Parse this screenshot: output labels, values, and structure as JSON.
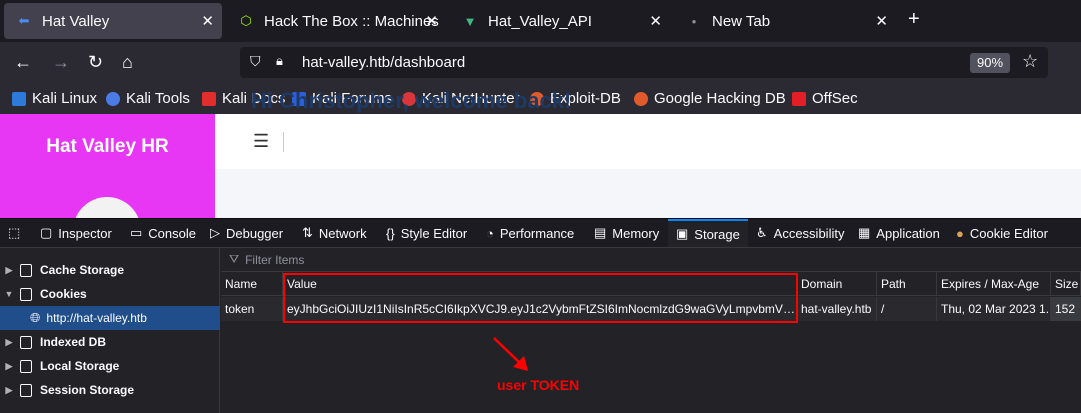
{
  "browser": {
    "tabs": [
      {
        "label": "Hat Valley",
        "active": true
      },
      {
        "label": "Hack The Box :: Machines",
        "active": false
      },
      {
        "label": "Hat_Valley_API",
        "active": false
      },
      {
        "label": "New Tab",
        "active": false
      }
    ],
    "close_glyph": "✕",
    "new_tab_glyph": "+",
    "url": "hat-valley.htb/dashboard",
    "zoom": "90%",
    "bookmarks": [
      {
        "label": "Kali Linux",
        "color": "#2c7bd8"
      },
      {
        "label": "Kali Tools",
        "color": "#4b7be5"
      },
      {
        "label": "Kali Docs",
        "color": "#e22d2d"
      },
      {
        "label": "Kali Forums",
        "color": "#ffffff"
      },
      {
        "label": "Kali NetHunter",
        "color": "#d8363a"
      },
      {
        "label": "Exploit-DB",
        "color": "#e05a2b"
      },
      {
        "label": "Google Hacking DB",
        "color": "#e05a2b"
      },
      {
        "label": "OffSec",
        "color": "#e21f26"
      }
    ]
  },
  "page": {
    "brand": "Hat Valley HR",
    "welcome": "Hi Christopher, welcome back!",
    "sidebar_color": "#e737f5"
  },
  "devtools": {
    "tabs": [
      "Inspector",
      "Console",
      "Debugger",
      "Network",
      "Style Editor",
      "Performance",
      "Memory",
      "Storage",
      "Accessibility",
      "Application",
      "Cookie Editor"
    ],
    "active_tab": "Storage",
    "tree": [
      {
        "label": "Cache Storage",
        "expanded": false
      },
      {
        "label": "Cookies",
        "expanded": true
      },
      {
        "label": "http://hat-valley.htb",
        "selected": true
      },
      {
        "label": "Indexed DB",
        "expanded": false
      },
      {
        "label": "Local Storage",
        "expanded": false
      },
      {
        "label": "Session Storage",
        "expanded": false
      }
    ],
    "filter_placeholder": "Filter Items",
    "columns": [
      "Name",
      "Value",
      "Domain",
      "Path",
      "Expires / Max-Age",
      "Size"
    ],
    "row": {
      "name": "token",
      "value": "eyJhbGciOiJIUzI1NiIsInR5cCI6IkpXVCJ9.eyJ1c2VybmFtZSI6ImNocmlzdG9waGVyLmpvbmVzIiwiaWF0...",
      "domain": "hat-valley.htb",
      "path": "/",
      "expires": "Thu, 02 Mar 2023 1...",
      "size": "152"
    }
  },
  "annotation": {
    "text": "user TOKEN",
    "color": "#ff0000"
  }
}
